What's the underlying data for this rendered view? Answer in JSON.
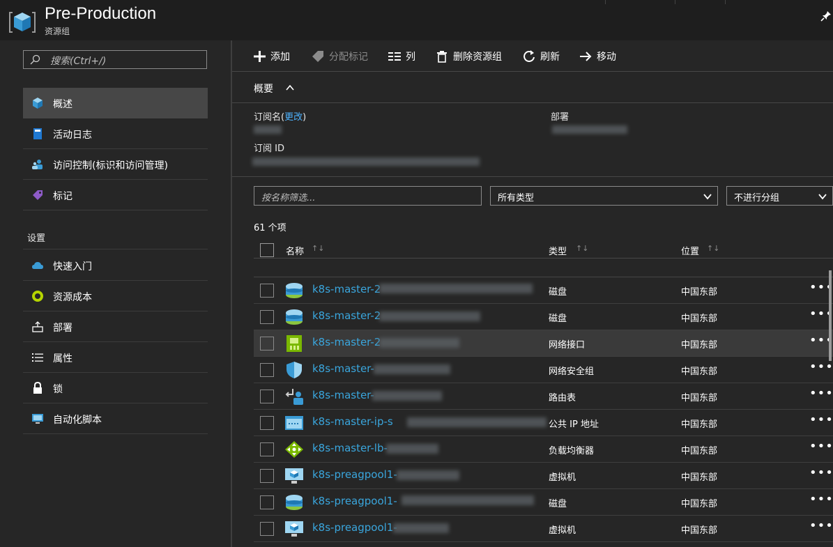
{
  "header": {
    "title": "Pre-Production",
    "subtitle": "资源组",
    "icon": "resource-group-cube-icon"
  },
  "sidebar": {
    "search_placeholder": "搜索(Ctrl+/)",
    "items": [
      {
        "label": "概述",
        "icon": "cube-icon",
        "active": true
      },
      {
        "label": "活动日志",
        "icon": "log-book-icon"
      },
      {
        "label": "访问控制(标识和访问管理)",
        "icon": "users-icon"
      },
      {
        "label": "标记",
        "icon": "tag-icon"
      }
    ],
    "settings_header": "设置",
    "settings_items": [
      {
        "label": "快速入门",
        "icon": "cloud-icon"
      },
      {
        "label": "资源成本",
        "icon": "cost-icon"
      },
      {
        "label": "部署",
        "icon": "deploy-icon"
      },
      {
        "label": "属性",
        "icon": "properties-icon"
      },
      {
        "label": "锁",
        "icon": "lock-icon"
      },
      {
        "label": "自动化脚本",
        "icon": "script-icon"
      }
    ]
  },
  "toolbar": {
    "add": "添加",
    "assign_tags": "分配标记",
    "columns": "列",
    "delete_group": "删除资源组",
    "refresh": "刷新",
    "move": "移动"
  },
  "essentials": {
    "title": "概要",
    "subscription_name_label": "订阅名",
    "change_link": "更改",
    "paren_open": "(",
    "paren_close": ")",
    "subscription_id_label": "订阅 ID",
    "deployments_label": "部署"
  },
  "filters": {
    "name_placeholder": "按名称筛选...",
    "type_value": "所有类型",
    "group_value": "不进行分组"
  },
  "list": {
    "count": "61 个项",
    "columns": {
      "name": "名称",
      "type": "类型",
      "location": "位置"
    },
    "sort_glyph": "↑↓",
    "more_glyph": "•••",
    "rows": [
      {
        "name": "k8s-master-2",
        "type": "磁盘",
        "location": "中国东部",
        "icon": "disk-icon"
      },
      {
        "name": "k8s-master-2",
        "type": "磁盘",
        "location": "中国东部",
        "icon": "disk-icon"
      },
      {
        "name": "k8s-master-2",
        "type": "网络接口",
        "location": "中国东部",
        "icon": "network-interface-icon"
      },
      {
        "name": "k8s-master-",
        "type": "网络安全组",
        "location": "中国东部",
        "icon": "security-group-icon"
      },
      {
        "name": "k8s-master-",
        "type": "路由表",
        "location": "中国东部",
        "icon": "route-table-icon"
      },
      {
        "name": "k8s-master-ip-s",
        "type": "公共 IP 地址",
        "location": "中国东部",
        "icon": "public-ip-icon"
      },
      {
        "name": "k8s-master-lb-",
        "type": "负载均衡器",
        "location": "中国东部",
        "icon": "load-balancer-icon"
      },
      {
        "name": "k8s-preagpool1-",
        "type": "虚拟机",
        "location": "中国东部",
        "icon": "vm-icon"
      },
      {
        "name": "k8s-preagpool1-",
        "type": "磁盘",
        "location": "中国东部",
        "icon": "disk-icon"
      },
      {
        "name": "k8s-preagpool1-",
        "type": "虚拟机",
        "location": "中国东部",
        "icon": "vm-icon"
      }
    ]
  },
  "colors": {
    "link": "#3aa6dd",
    "accent": "#4db3ff",
    "background": "#262626"
  }
}
